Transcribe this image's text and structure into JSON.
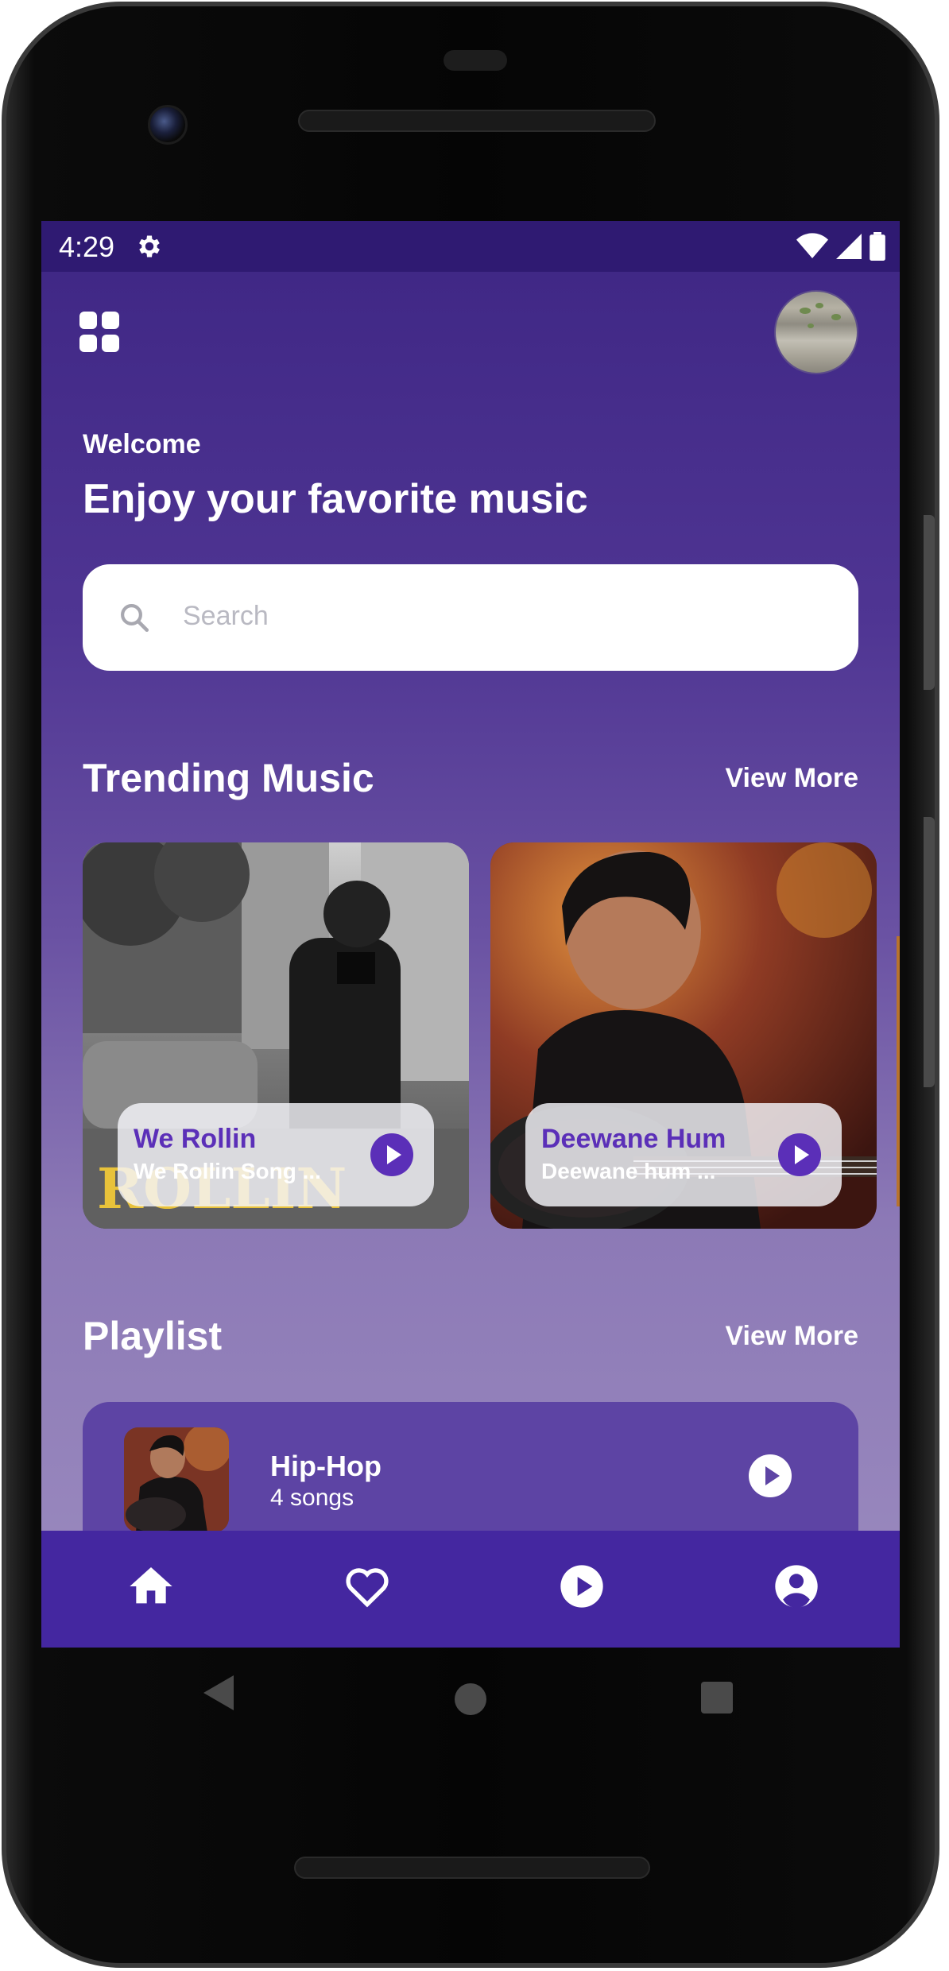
{
  "status_bar": {
    "time": "4:29"
  },
  "header": {
    "welcome": "Welcome",
    "headline": "Enjoy your favorite music"
  },
  "search": {
    "placeholder": "Search"
  },
  "trending": {
    "title": "Trending Music",
    "view_more": "View More",
    "cards": [
      {
        "title": "We Rollin",
        "subtitle": "We Rollin Song ..."
      },
      {
        "title": "Deewane Hum",
        "subtitle": "Deewane hum ..."
      }
    ]
  },
  "playlist": {
    "title": "Playlist",
    "view_more": "View More",
    "items": [
      {
        "title": "Hip-Hop",
        "count": "4 songs"
      }
    ]
  },
  "colors": {
    "accent": "#5b2fb8",
    "nav_bg": "#4427a0",
    "status_bg": "#2f1a72"
  },
  "icons": [
    "settings-icon",
    "wifi-icon",
    "signal-icon",
    "battery-icon",
    "grid-menu-icon",
    "search-icon",
    "play-icon",
    "home-icon",
    "heart-icon",
    "profile-icon"
  ]
}
